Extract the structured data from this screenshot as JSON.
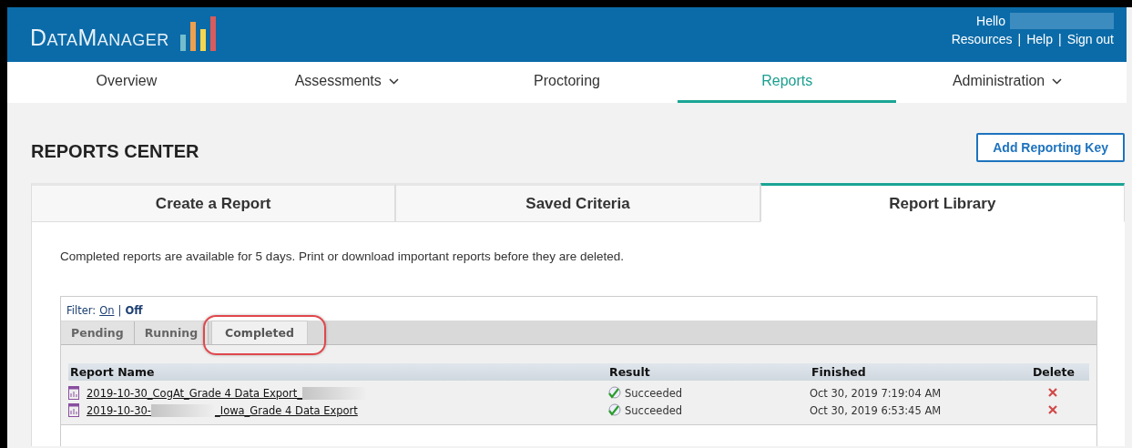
{
  "header": {
    "logo": "DataManager",
    "greeting": "Hello",
    "links": [
      "Resources",
      "Help",
      "Sign out"
    ],
    "separator": "|"
  },
  "nav": [
    {
      "label": "Overview",
      "selected": false,
      "dropdown": false
    },
    {
      "label": "Assessments",
      "selected": false,
      "dropdown": true
    },
    {
      "label": "Proctoring",
      "selected": false,
      "dropdown": false
    },
    {
      "label": "Reports",
      "selected": true,
      "dropdown": false
    },
    {
      "label": "Administration",
      "selected": false,
      "dropdown": true
    }
  ],
  "page_title": "REPORTS CENTER",
  "add_button": "Add Reporting Key",
  "tabs": [
    {
      "label": "Create a Report",
      "selected": false
    },
    {
      "label": "Saved Criteria",
      "selected": false
    },
    {
      "label": "Report Library",
      "selected": true
    }
  ],
  "notice": "Completed reports are available for 5 days. Print or download important reports before they are deleted.",
  "filter": {
    "label": "Filter:",
    "separator": "|",
    "options": [
      {
        "label": "On",
        "selected": false
      },
      {
        "label": "Off",
        "selected": true
      }
    ]
  },
  "status_tabs": [
    {
      "label": "Pending",
      "selected": false,
      "highlighted": false
    },
    {
      "label": "Running",
      "selected": false,
      "highlighted": false
    },
    {
      "label": "Completed",
      "selected": true,
      "highlighted": true
    }
  ],
  "table": {
    "columns": [
      "Report Name",
      "Result",
      "Finished",
      "Delete"
    ],
    "rows": [
      {
        "name": [
          {
            "kind": "text",
            "text": "2019-10-30_CogAt_Grade 4 Data Export_"
          },
          {
            "kind": "redacted"
          }
        ],
        "result": "Succeeded",
        "finished": "Oct 30, 2019 7:19:04 AM"
      },
      {
        "name": [
          {
            "kind": "text",
            "text": "2019-10-30-"
          },
          {
            "kind": "redacted"
          },
          {
            "kind": "text",
            "text": "_Iowa_Grade 4 Data Export"
          }
        ],
        "result": "Succeeded",
        "finished": "Oct 30, 2019 6:53:45 AM"
      }
    ]
  }
}
